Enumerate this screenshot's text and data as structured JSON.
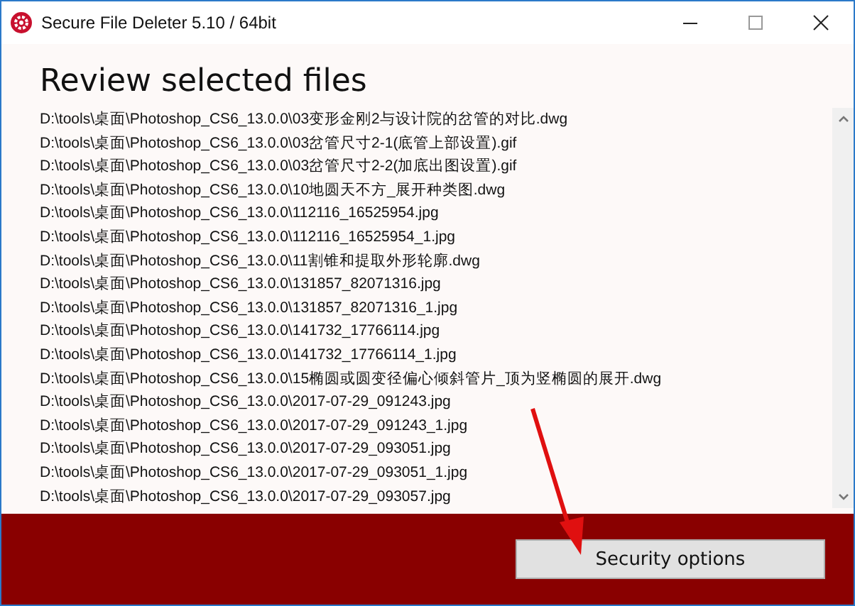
{
  "window": {
    "title": "Secure File Deleter 5.10 / 64bit"
  },
  "heading": "Review selected files",
  "files": [
    "D:\\tools\\桌面\\Photoshop_CS6_13.0.0\\03变形金刚2与设计院的岔管的对比.dwg",
    "D:\\tools\\桌面\\Photoshop_CS6_13.0.0\\03岔管尺寸2-1(底管上部设置).gif",
    "D:\\tools\\桌面\\Photoshop_CS6_13.0.0\\03岔管尺寸2-2(加底出图设置).gif",
    "D:\\tools\\桌面\\Photoshop_CS6_13.0.0\\10地圆天不方_展开种类图.dwg",
    "D:\\tools\\桌面\\Photoshop_CS6_13.0.0\\112116_16525954.jpg",
    "D:\\tools\\桌面\\Photoshop_CS6_13.0.0\\112116_16525954_1.jpg",
    "D:\\tools\\桌面\\Photoshop_CS6_13.0.0\\11割锥和提取外形轮廓.dwg",
    "D:\\tools\\桌面\\Photoshop_CS6_13.0.0\\131857_82071316.jpg",
    "D:\\tools\\桌面\\Photoshop_CS6_13.0.0\\131857_82071316_1.jpg",
    "D:\\tools\\桌面\\Photoshop_CS6_13.0.0\\141732_17766114.jpg",
    "D:\\tools\\桌面\\Photoshop_CS6_13.0.0\\141732_17766114_1.jpg",
    "D:\\tools\\桌面\\Photoshop_CS6_13.0.0\\15椭圆或圆变径偏心倾斜管片_顶为竖椭圆的展开.dwg",
    "D:\\tools\\桌面\\Photoshop_CS6_13.0.0\\2017-07-29_091243.jpg",
    "D:\\tools\\桌面\\Photoshop_CS6_13.0.0\\2017-07-29_091243_1.jpg",
    "D:\\tools\\桌面\\Photoshop_CS6_13.0.0\\2017-07-29_093051.jpg",
    "D:\\tools\\桌面\\Photoshop_CS6_13.0.0\\2017-07-29_093051_1.jpg",
    "D:\\tools\\桌面\\Photoshop_CS6_13.0.0\\2017-07-29_093057.jpg"
  ],
  "button": "Security options"
}
